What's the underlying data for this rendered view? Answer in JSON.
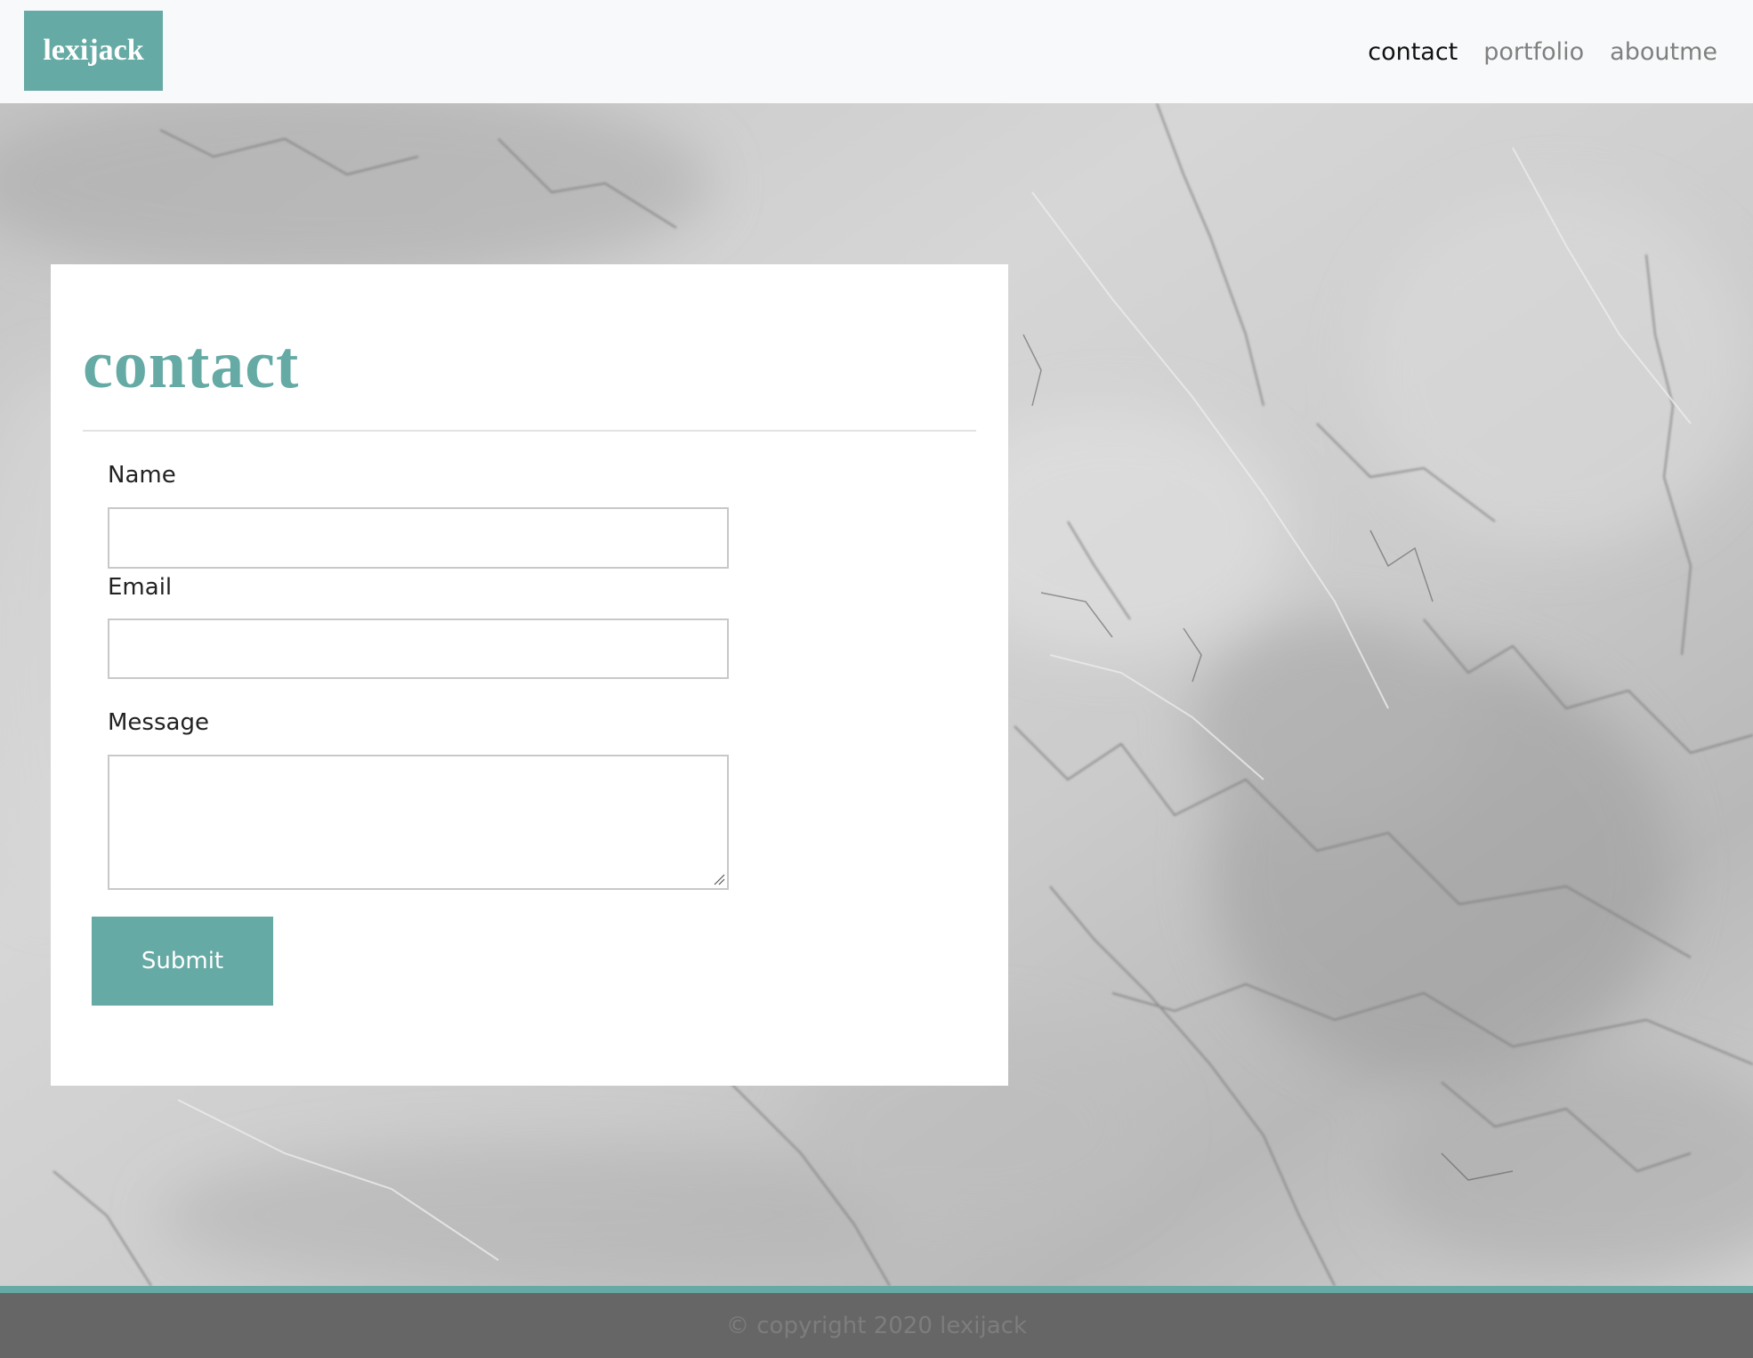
{
  "brand": {
    "name": "lexijack"
  },
  "nav": {
    "items": [
      {
        "label": "contact",
        "active": true
      },
      {
        "label": "portfolio",
        "active": false
      },
      {
        "label": "aboutme",
        "active": false
      }
    ]
  },
  "contact_card": {
    "title": "contact",
    "fields": {
      "name": {
        "label": "Name",
        "value": ""
      },
      "email": {
        "label": "Email",
        "value": ""
      },
      "message": {
        "label": "Message",
        "value": ""
      }
    },
    "submit_label": "Submit"
  },
  "footer": {
    "text": "© copyright 2020 lexijack"
  },
  "colors": {
    "accent": "#65aaa4",
    "navbar_bg": "#f8f9fa",
    "footer_bg": "#666666",
    "nav_active": "#111111",
    "nav_inactive": "#808080"
  },
  "background": {
    "texture": "grey-marble"
  }
}
